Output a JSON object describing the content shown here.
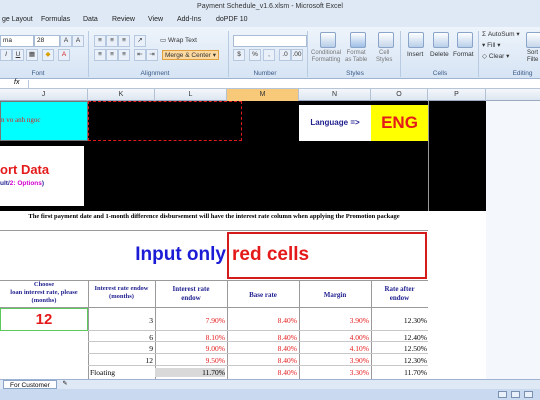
{
  "window": {
    "title": "Payment Schedule_v1.6.xlsm - Microsoft Excel"
  },
  "tabs": [
    "ge Layout",
    "Formulas",
    "Data",
    "Review",
    "View",
    "Add-Ins",
    "doPDF 10"
  ],
  "ribbon": {
    "font_name": "ma",
    "font_size": "28",
    "wrap_text": "Wrap Text",
    "merge_center": "Merge & Center",
    "number_format": "",
    "currency": "$",
    "percent": "%",
    "comma": ",",
    "conditional_formatting": "Conditional\nFormatting",
    "format_as_table": "Format\nas Table",
    "cell_styles": "Cell\nStyles",
    "insert": "Insert",
    "delete": "Delete",
    "format": "Format",
    "autosum": "AutoSum",
    "fill": "Fill",
    "clear": "Clear",
    "sort_filter": "Sort\nFilte",
    "groups": {
      "font": "Font",
      "alignment": "Alignment",
      "number": "Number",
      "styles": "Styles",
      "cells": "Cells",
      "editing": "Editing"
    }
  },
  "formula_bar": {
    "fx": "fx"
  },
  "columns": [
    "J",
    "K",
    "L",
    "M",
    "N",
    "O",
    "P"
  ],
  "sheet": {
    "note_text": "n vo anh ngoc",
    "language_label": "Language =>",
    "language_value": "ENG",
    "sort_data_title": "ort Data",
    "sort_data_sub_prefix": "ult/",
    "sort_data_sub_option": "2: Options",
    "sort_data_sub_suffix": ")",
    "notice": "The first payment date and 1-month difference disbursement will have the interest rate column when applying the Promotion package",
    "input_only": "Input only",
    "red_cells": "red cells",
    "headers": {
      "choose": "Choose\nloan interest rate, please\n(months)",
      "period": "Interest rate endow\n(months)",
      "endow": "Interest rate\nendow",
      "base": "Base rate",
      "margin": "Margin",
      "after": "Rate after\nendow"
    },
    "choice_value": "12",
    "rows": [
      {
        "period": "3",
        "endow": "7.90%",
        "base": "8.40%",
        "margin": "3.90%",
        "after": "12.30%"
      },
      {
        "period": "6",
        "endow": "8.10%",
        "base": "8.40%",
        "margin": "4.00%",
        "after": "12.40%"
      },
      {
        "period": "9",
        "endow": "9.00%",
        "base": "8.40%",
        "margin": "4.10%",
        "after": "12.50%"
      },
      {
        "period": "12",
        "endow": "9.50%",
        "base": "8.40%",
        "margin": "3.90%",
        "after": "12.30%"
      },
      {
        "period": "Floating",
        "endow": "11.70%",
        "base": "8.40%",
        "margin": "3.30%",
        "after": "11.70%"
      }
    ]
  },
  "sheet_tabs": {
    "active": "For Customer"
  },
  "colors": {
    "cyan": "#00ffff",
    "yellow": "#ffff00",
    "red": "#e41a1a",
    "blue": "#1c1cd6",
    "navy": "#1f1f8f",
    "green_border": "#5cc95c"
  }
}
